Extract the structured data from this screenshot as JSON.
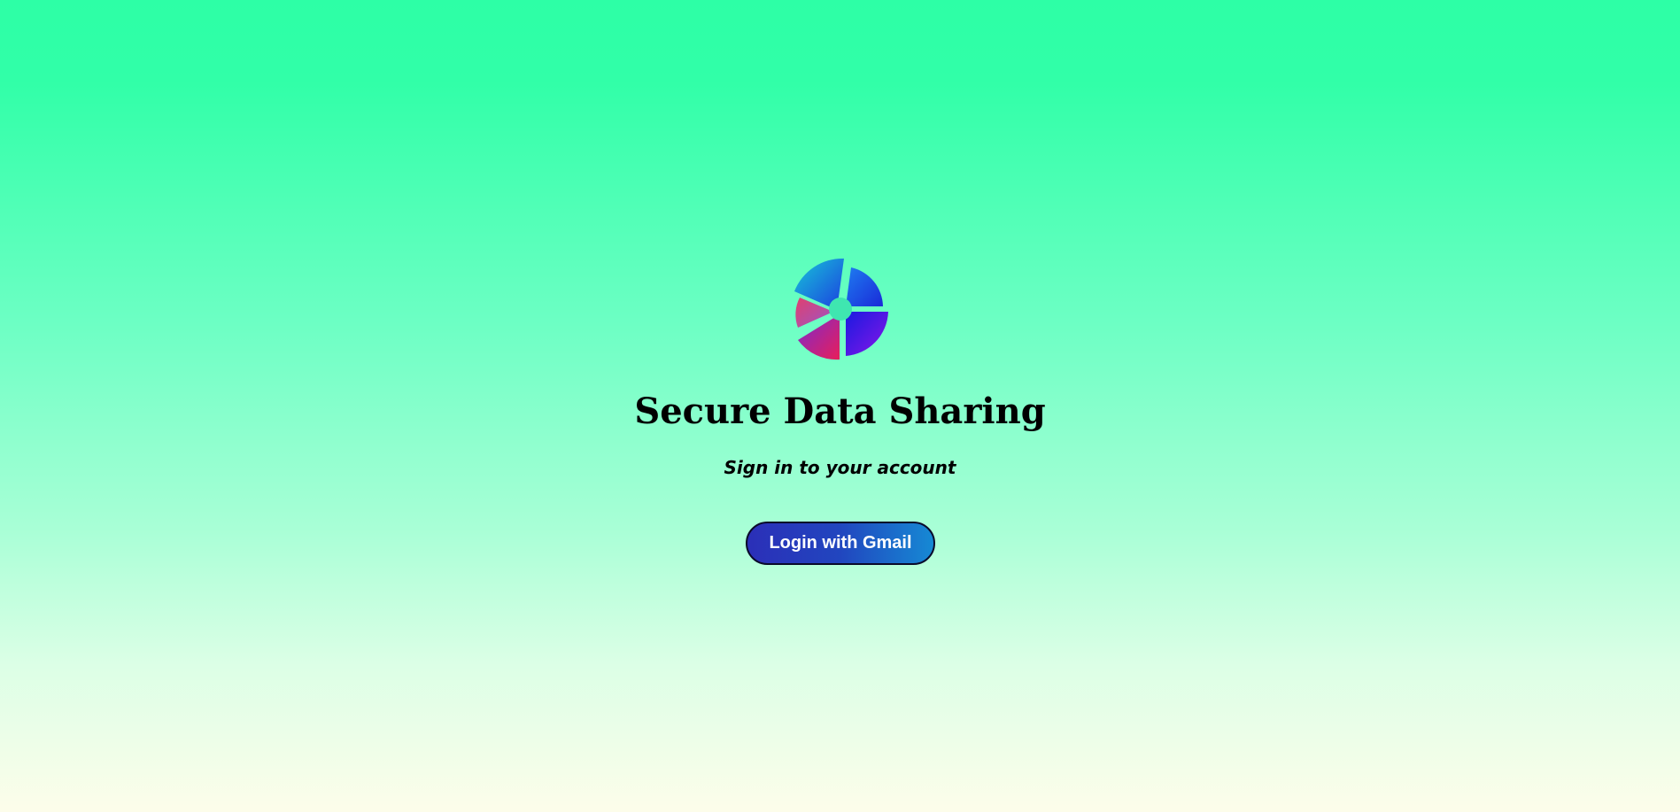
{
  "app": {
    "title": "Secure Data Sharing",
    "subtitle": "Sign in to your account"
  },
  "login": {
    "button_label": "Login with Gmail"
  },
  "logo": {
    "icon": "shutter-logo-icon"
  },
  "colors": {
    "background_top": "#2dffa6",
    "background_bottom": "#fdfdea",
    "button_start": "#2b2fb8",
    "button_end": "#1689d4",
    "button_text": "#ffffff",
    "text": "#000000"
  }
}
